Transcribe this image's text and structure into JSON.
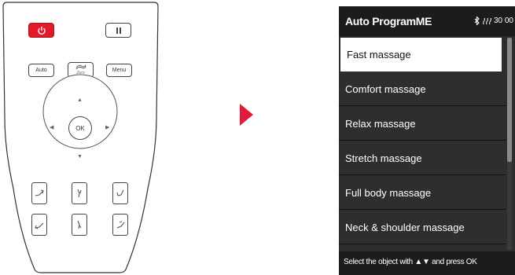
{
  "remote": {
    "buttons": {
      "auto_label": "Auto",
      "zero_label": "Zero",
      "menu_label": "Menu",
      "ok_label": "OK"
    },
    "icons": [
      "power-icon",
      "pause-icon",
      "zero-gravity-icon",
      "chair-recline-icon",
      "leg-rest-icon",
      "chair-upright-icon"
    ]
  },
  "screen": {
    "title": "Auto ProgramME",
    "status": {
      "bluetooth_icon": "bluetooth-icon",
      "heat_icon": "heat-icon",
      "timer": "30 00"
    },
    "items": [
      {
        "label": "Fast massage",
        "selected": true
      },
      {
        "label": "Comfort massage",
        "selected": false
      },
      {
        "label": "Relax massage",
        "selected": false
      },
      {
        "label": "Stretch massage",
        "selected": false
      },
      {
        "label": "Full body massage",
        "selected": false
      },
      {
        "label": "Neck & shoulder massage",
        "selected": false
      }
    ],
    "footer": {
      "prefix": "Select the object with",
      "suffix": "and press OK"
    }
  },
  "colors": {
    "power_red": "#e21b2a",
    "pointer_red": "#e21b3b",
    "screen_bg": "#2e2e2e",
    "header_bg": "#1c1c1c"
  }
}
